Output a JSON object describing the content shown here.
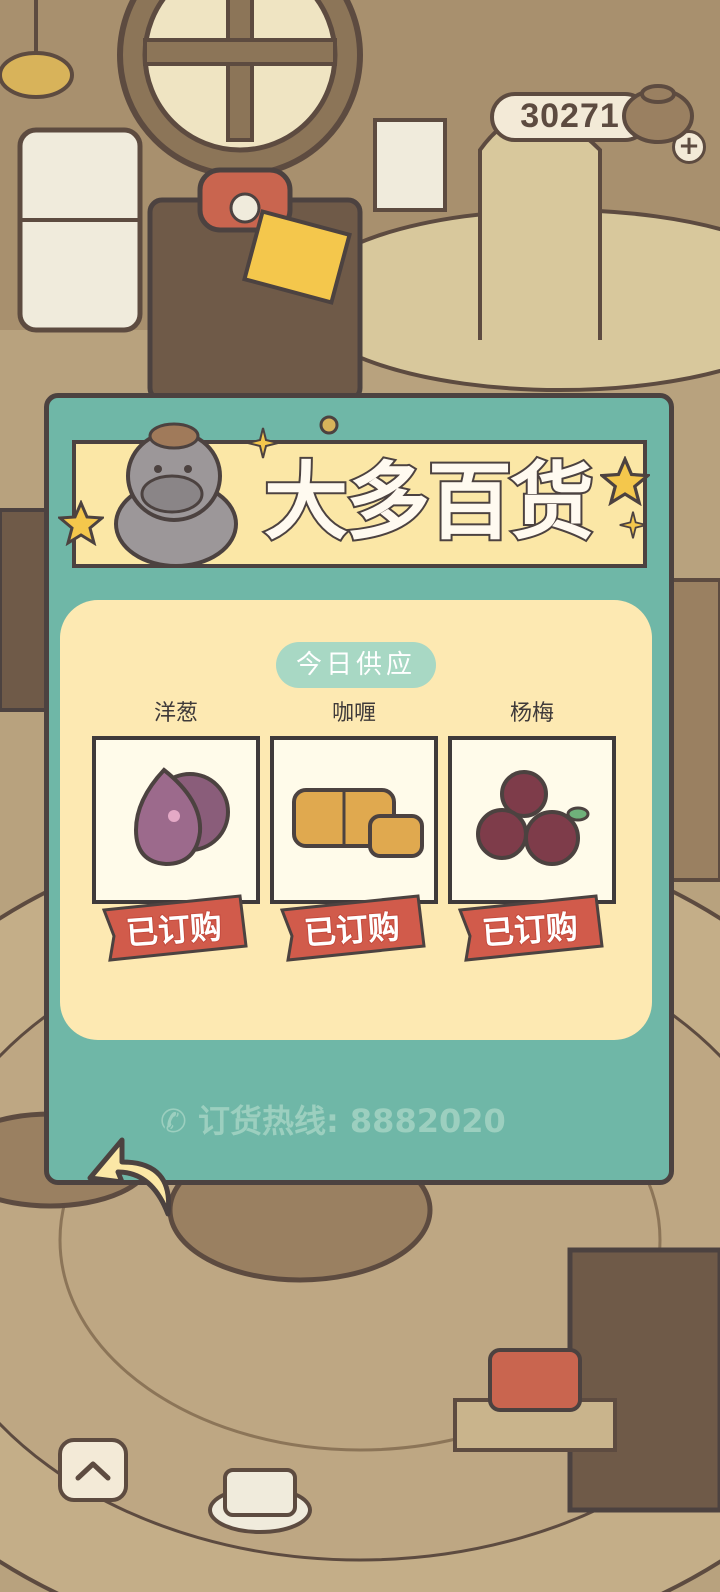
{
  "hud": {
    "coins": "30271",
    "plus_icon": "plus-icon",
    "colors": {
      "pill": "#f3ead7",
      "outline": "#5d4b40"
    }
  },
  "shop": {
    "title": "大多百货",
    "mascot_icon": "hippo-mascot-icon",
    "section_label": "今日供应",
    "items": [
      {
        "name": "洋葱",
        "status": "已订购",
        "icon": "onion-icon"
      },
      {
        "name": "咖喱",
        "status": "已订购",
        "icon": "curry-icon"
      },
      {
        "name": "杨梅",
        "status": "已订购",
        "icon": "bayberry-icon"
      }
    ],
    "hotline_label": "订货热线:",
    "hotline_number": "8882020",
    "colors": {
      "panel": "#6fb7a7",
      "banner": "#fbe7a6",
      "cream": "#fde9b2",
      "stamp": "#d15b4b",
      "outline": "#4c4240"
    }
  },
  "nav": {
    "back_icon": "back-arrow-icon",
    "up_icon": "chevron-up-icon"
  }
}
